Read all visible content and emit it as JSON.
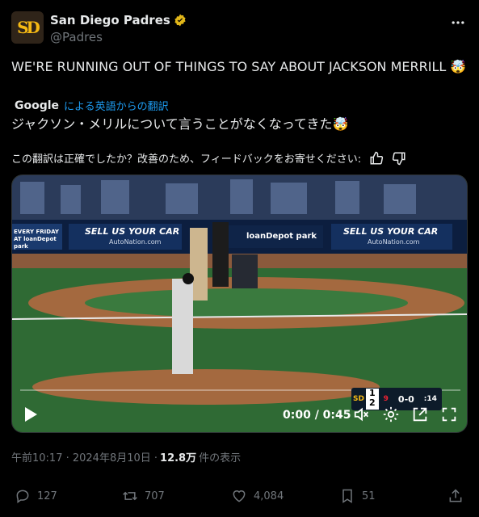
{
  "author": {
    "display_name": "San Diego Padres",
    "handle": "@Padres",
    "avatar_text": "SD",
    "brand_color": "#f5b914",
    "verified_icon": "verified-badge-gold-icon"
  },
  "tweet": {
    "text": "WE'RE RUNNING OUT OF THINGS TO SAY ABOUT JACKSON MERRILL 🤯",
    "translate_brand": "Google",
    "translate_link": "による英語からの翻訳",
    "translated_text": "ジャクソン・メリルについて言うことがなくなってきた🤯",
    "feedback_prompt": "この翻訳は正確でしたか？改善のため、フィードバックをお寄せください:"
  },
  "video": {
    "time": "0:00 / 0:45",
    "progress": 0,
    "scoreboard": {
      "team_logo": "SD",
      "score_top": "1",
      "score_bottom": "2",
      "inning": "9",
      "count": "0-0",
      "pitch_clock": ":14"
    },
    "ads": {
      "banner_1": "SELL US YOUR CAR",
      "banner_1_sub": "AutoNation.com",
      "banner_2": "SELL US YOUR CAR",
      "banner_2_sub": "AutoNation.com",
      "banner_3": "loanDepot park",
      "banner_4": "EVERY FRIDAY AT loanDepot park"
    }
  },
  "meta": {
    "timestamp": "午前10:17 · 2024年8月10日 · ",
    "views": "12.8万",
    "views_label": "件の表示"
  },
  "actions": {
    "replies": "127",
    "reposts": "707",
    "likes": "4,084",
    "bookmarks": "51"
  },
  "colors": {
    "background": "#000000",
    "text": "#e7e9ea",
    "secondary": "#71767b",
    "link": "#1d9bf0"
  }
}
